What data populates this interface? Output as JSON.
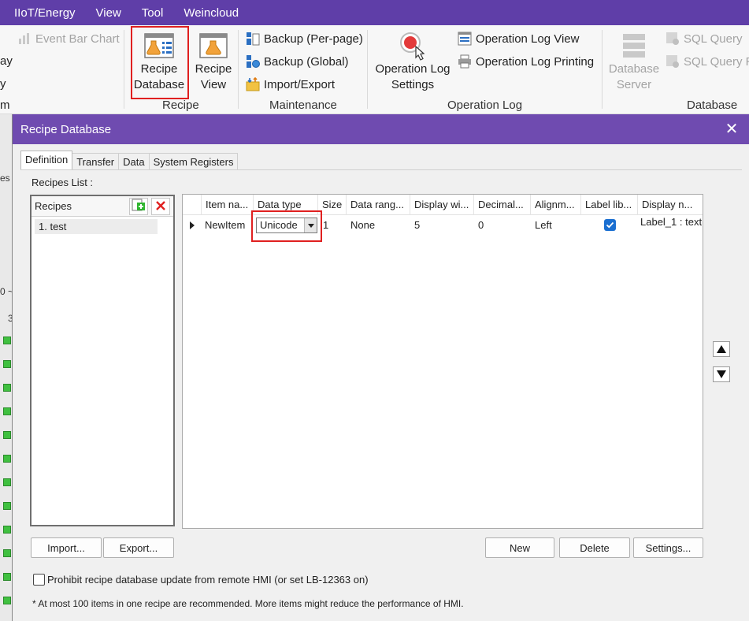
{
  "menu": [
    "IIoT/Energy",
    "View",
    "Tool",
    "Weincloud"
  ],
  "ribbon": {
    "left_fragments": [
      "ay",
      "y",
      "m"
    ],
    "event_bar_chart": "Event Bar Chart",
    "recipe_group": {
      "label": "Recipe",
      "recipe_database": [
        "Recipe",
        "Database"
      ],
      "recipe_view": [
        "Recipe",
        "View"
      ]
    },
    "maintenance_group": {
      "label": "Maintenance",
      "items": [
        "Backup (Per-page)",
        "Backup (Global)",
        "Import/Export"
      ]
    },
    "operation_log_group": {
      "label": "Operation Log",
      "settings": [
        "Operation Log",
        "Settings"
      ],
      "items": [
        "Operation Log View",
        "Operation Log Printing"
      ]
    },
    "database_group": {
      "label": "Database",
      "server": [
        "Database",
        "Server"
      ],
      "items": [
        "SQL Query",
        "SQL Query R"
      ]
    }
  },
  "background_fragments": [
    "es",
    "0 ~",
    "3"
  ],
  "dialog": {
    "title": "Recipe Database",
    "tabs": [
      "Definition",
      "Transfer",
      "Data",
      "System Registers"
    ],
    "recipes_list_label": "Recipes List :",
    "recipes_header": "Recipes",
    "recipes": [
      "1. test"
    ],
    "columns": [
      "Item na...",
      "Data type",
      "Size",
      "Data rang...",
      "Display wi...",
      "Decimal...",
      "Alignm...",
      "Label lib...",
      "Display n..."
    ],
    "row": {
      "item_name": "NewItem",
      "data_type": "Unicode",
      "size": "1",
      "data_range": "None",
      "display_width": "5",
      "decimal": "0",
      "alignment": "Left",
      "label_library": true,
      "display_name": "Label_1 : text"
    },
    "buttons": {
      "import": "Import...",
      "export": "Export...",
      "new": "New",
      "delete": "Delete",
      "settings": "Settings..."
    },
    "prohibit_label": "Prohibit recipe database update from remote HMI (or set LB-12363 on)",
    "note": "* At most 100 items in one recipe are recommended. More items might reduce the performance of HMI."
  }
}
